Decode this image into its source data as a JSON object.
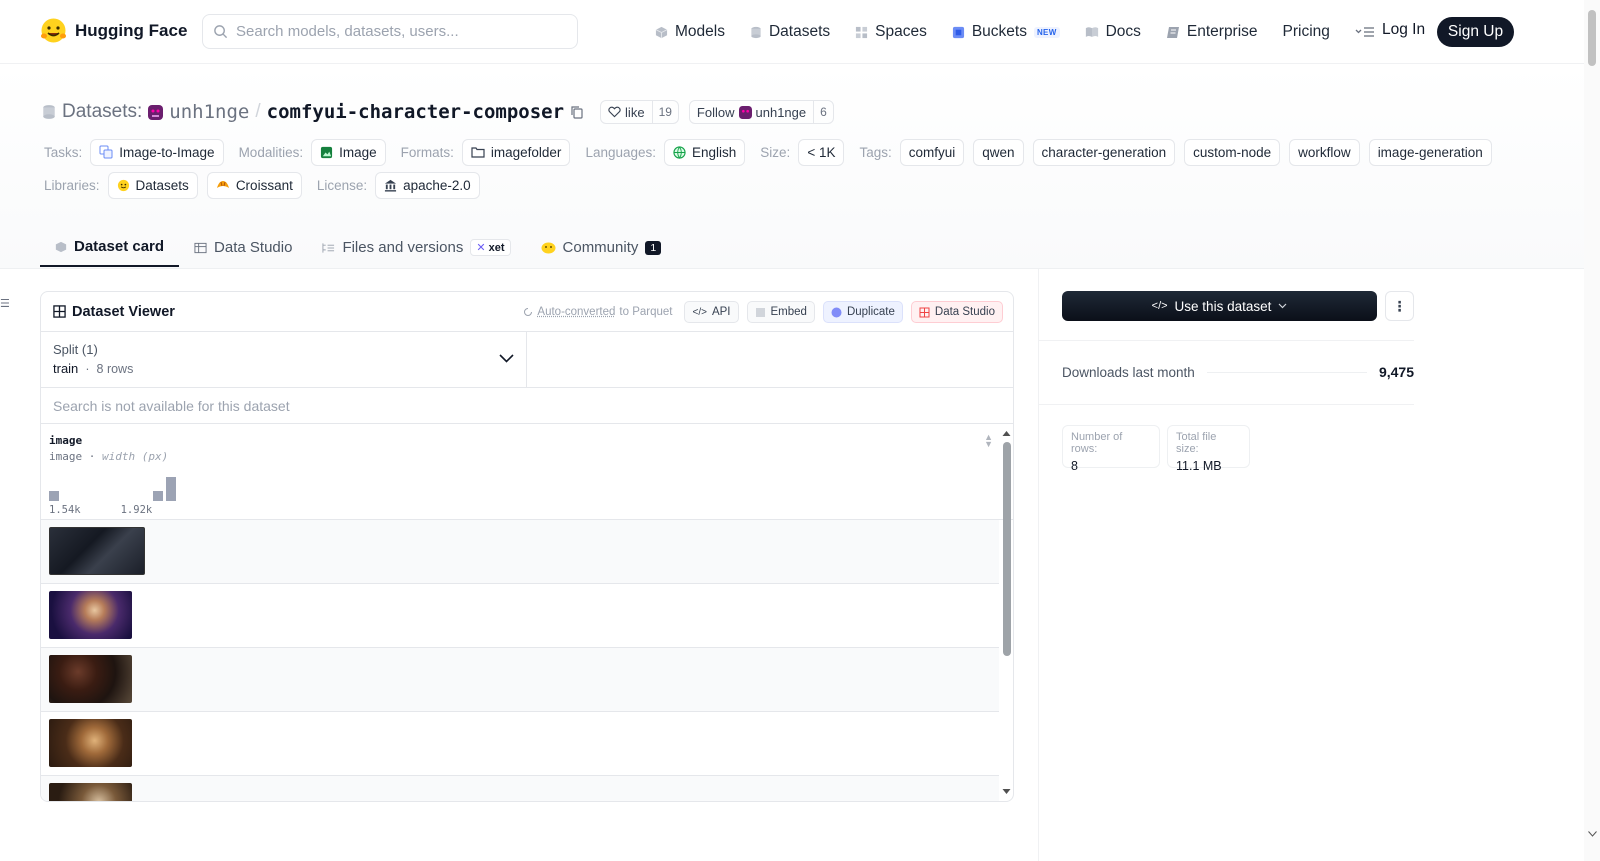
{
  "nav": {
    "brand": "Hugging Face",
    "search_placeholder": "Search models, datasets, users...",
    "links": [
      {
        "label": "Models",
        "icon": "cube-icon"
      },
      {
        "label": "Datasets",
        "icon": "database-icon"
      },
      {
        "label": "Spaces",
        "icon": "grid-icon"
      },
      {
        "label": "Buckets",
        "icon": "bucket-icon",
        "badge": "NEW"
      },
      {
        "label": "Docs",
        "icon": "book-icon"
      },
      {
        "label": "Enterprise",
        "icon": "enterprise-icon"
      },
      {
        "label": "Pricing"
      }
    ],
    "login": "Log In",
    "signup": "Sign Up"
  },
  "header": {
    "datasets_label": "Datasets:",
    "owner": "unh1nge",
    "repo": "comfyui-character-composer",
    "like_label": "like",
    "like_count": "19",
    "follow_label": "Follow",
    "follow_user": "unh1nge",
    "follow_count": "6",
    "tasks_label": "Tasks:",
    "task": "Image-to-Image",
    "modalities_label": "Modalities:",
    "modality": "Image",
    "formats_label": "Formats:",
    "format": "imagefolder",
    "languages_label": "Languages:",
    "language": "English",
    "size_label": "Size:",
    "size": "< 1K",
    "tags_label": "Tags:",
    "tags": [
      "comfyui",
      "qwen",
      "character-generation",
      "custom-node",
      "workflow",
      "image-generation"
    ],
    "libraries_label": "Libraries:",
    "libraries": [
      "Datasets",
      "Croissant"
    ],
    "license_label": "License:",
    "license": "apache-2.0"
  },
  "tabs": {
    "card": "Dataset card",
    "studio": "Data Studio",
    "files": "Files and versions",
    "xet": "xet",
    "community": "Community",
    "community_count": "1"
  },
  "viewer": {
    "title": "Dataset Viewer",
    "auto_converted": "Auto-converted",
    "to_parquet": "to Parquet",
    "api": "API",
    "embed": "Embed",
    "duplicate": "Duplicate",
    "data_studio": "Data Studio",
    "split_label": "Split (1)",
    "split_name": "train",
    "split_rows": "8 rows",
    "search_na": "Search is not available for this dataset",
    "column_name": "image",
    "column_type": "image",
    "column_stat": "width (px)",
    "hist_min": "1.54k",
    "hist_max": "1.92k",
    "hist_bars": [
      0.4,
      0.4,
      1.0
    ]
  },
  "sidebar": {
    "use_button": "Use this dataset",
    "downloads_label": "Downloads last month",
    "downloads_value": "9,475",
    "rows_label": "Number of rows:",
    "rows_value": "8",
    "size_label": "Total file size:",
    "size_value": "11.1 MB"
  }
}
